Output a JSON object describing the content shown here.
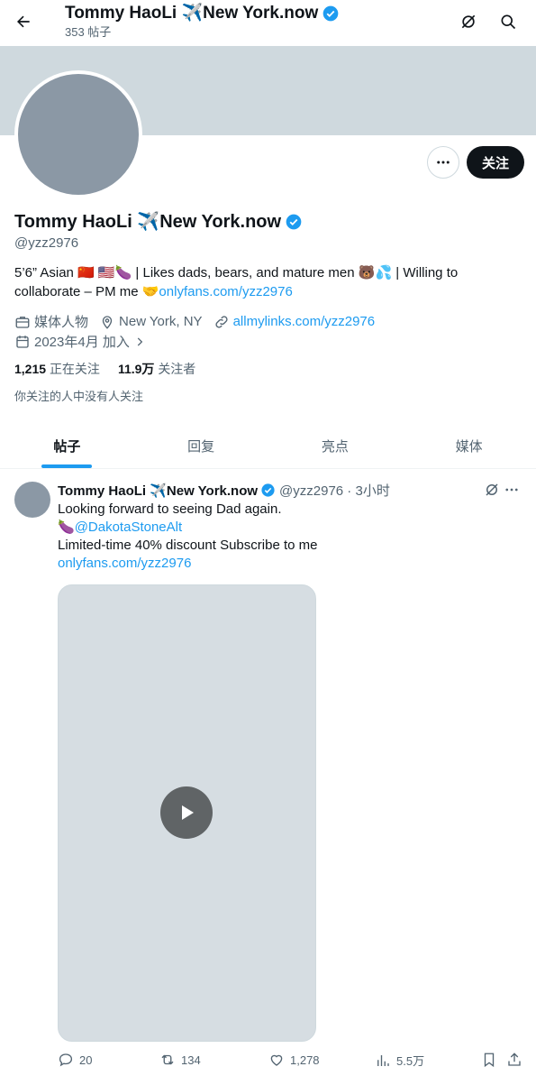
{
  "header": {
    "title": "Tommy HaoLi ✈️New York.now",
    "posts_count": "353 帖子"
  },
  "profile": {
    "name": "Tommy HaoLi ✈️New York.now",
    "handle": "@yzz2976",
    "follow_label": "关注",
    "bio_line1": "5’6” Asian 🇨🇳 🇺🇸🍆 | Likes dads, bears, and mature men 🐻💦 | Willing to",
    "bio_line2_prefix": "collaborate – PM me 🤝",
    "bio_link": "onlyfans.com/yzz2976",
    "category": "媒体人物",
    "location": "New York, NY",
    "website": "allmylinks.com/yzz2976",
    "joined": "2023年4月 加入",
    "following_count": "1,215",
    "following_label": "正在关注",
    "followers_count": "11.9万",
    "followers_label": "关注者",
    "followed_by": "你关注的人中没有人关注"
  },
  "tabs": [
    "帖子",
    "回复",
    "亮点",
    "媒体"
  ],
  "post": {
    "name": "Tommy HaoLi ✈️New York.now",
    "meta": "@yzz2976 · 3小时",
    "line1": "Looking forward to seeing Dad again.",
    "line2_prefix": "🍆",
    "mention": "@DakotaStoneAlt",
    "line3": "Limited-time 40% discount Subscribe to me",
    "link": "onlyfans.com/yzz2976",
    "replies": "20",
    "reposts": "134",
    "likes": "1,278",
    "views": "5.5万"
  },
  "colors": {
    "accent": "#1d9bf0",
    "text": "#0f1419",
    "muted": "#536471"
  }
}
